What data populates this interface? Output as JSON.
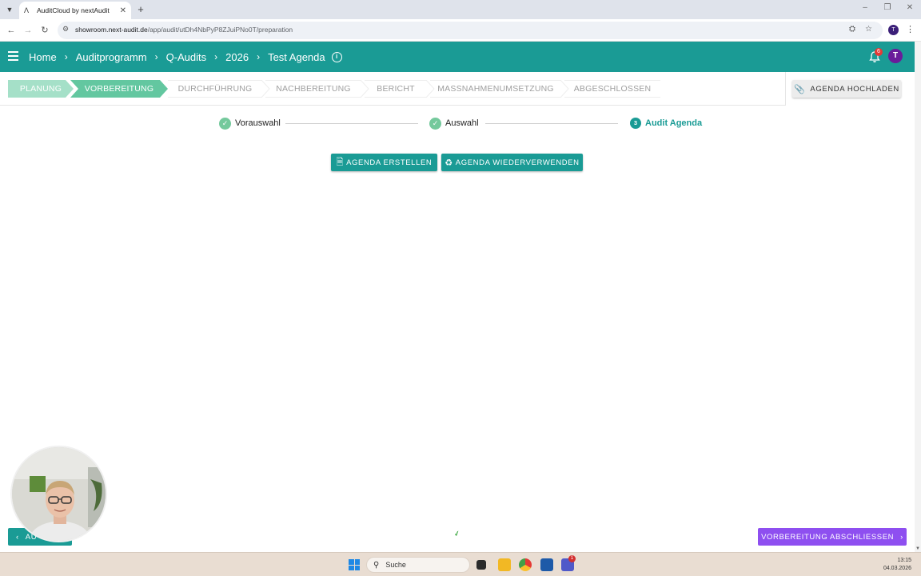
{
  "browser": {
    "tab_title": "AuditCloud by nextAudit",
    "url_host": "showroom.next-audit.de",
    "url_path": "/app/audit/utDh4NbPyP8ZJuiPNo0T/preparation",
    "profile_initial": "T"
  },
  "header": {
    "breadcrumbs": [
      "Home",
      "Auditprogramm",
      "Q-Audits",
      "2026",
      "Test Agenda"
    ],
    "notification_count": "6",
    "avatar_initial": "T"
  },
  "phases": [
    {
      "label": "PLANUNG",
      "state": "done"
    },
    {
      "label": "VORBEREITUNG",
      "state": "active"
    },
    {
      "label": "DURCHFÜHRUNG",
      "state": "todo"
    },
    {
      "label": "NACHBEREITUNG",
      "state": "todo"
    },
    {
      "label": "BERICHT",
      "state": "todo"
    },
    {
      "label": "MASSNAHMENUMSETZUNG",
      "state": "todo"
    },
    {
      "label": "ABGESCHLOSSEN",
      "state": "todo"
    }
  ],
  "upload_button": "AGENDA HOCHLADEN",
  "substeps": [
    {
      "label": "Vorauswahl",
      "state": "done"
    },
    {
      "label": "Auswahl",
      "state": "done"
    },
    {
      "label": "Audit Agenda",
      "number": "3",
      "state": "current"
    }
  ],
  "actions": {
    "create": "AGENDA ERSTELLEN",
    "reuse": "AGENDA WIEDERVERWENDEN"
  },
  "footer": {
    "back_label": "AU",
    "next_label": "VORBEREITUNG ABSCHLIESSEN"
  },
  "taskbar": {
    "search_placeholder": "Suche",
    "badge": "1",
    "time": "13:15",
    "date": "04.03.2026"
  },
  "colors": {
    "primary": "#1a9b95",
    "phase_done": "#a5e0c8",
    "phase_active": "#63c7a0",
    "next_button": "#8e4ff0",
    "avatar": "#6a1b9a"
  }
}
